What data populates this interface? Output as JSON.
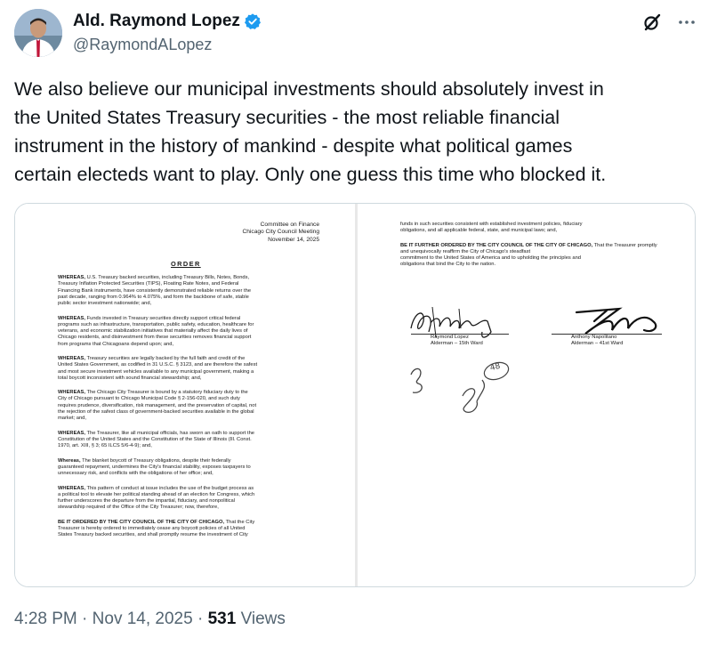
{
  "author": {
    "name": "Ald. Raymond Lopez",
    "handle": "@RaymondALopez",
    "verified_color": "#1d9bf0"
  },
  "icons": {
    "grok": "grok-icon",
    "more": "more-options-icon",
    "verified": "verified-badge-icon"
  },
  "tweet": {
    "lines": [
      "We also believe our municipal investments should absolutely invest in",
      "the United States Treasury securities - the most reliable financial",
      "instrument in the history of mankind - despite what political games",
      "certain electeds want to play. Only one guess this time who blocked it."
    ]
  },
  "document": {
    "left": {
      "header": [
        "Committee on Finance",
        "Chicago City Council Meeting",
        "November 14, 2025"
      ],
      "title": "ORDER",
      "paragraphs": [
        {
          "lead": "WHEREAS,",
          "lines": [
            "U.S. Treasury backed securities, including Treasury Bills, Notes, Bonds,",
            "Treasury Inflation Protected Securities (TIPS), Floating Rate Notes, and Federal",
            "Financing Bank instruments, have consistently demonstrated reliable returns over the",
            "past decade, ranging from 0.964% to 4.075%, and form the backbone of safe, stable",
            "public sector investment nationwide; and,"
          ]
        },
        {
          "lead": "WHEREAS,",
          "lines": [
            "Funds invested in Treasury securities directly support critical federal",
            "programs such as infrastructure, transportation, public safety, education, healthcare for",
            "veterans, and economic stabilization initiatives that materially affect the daily lives of",
            "Chicago residents, and disinvestment from these securities removes financial support",
            "from programs that Chicagoans depend upon; and,"
          ]
        },
        {
          "lead": "WHEREAS,",
          "lines": [
            "Treasury securities are legally backed by the full faith and credit of the",
            "United States Government, as codified in 31 U.S.C. § 3123, and are therefore the safest",
            "and most secure investment vehicles available to any municipal government, making a",
            "total boycott inconsistent with sound financial stewardship; and,"
          ]
        },
        {
          "lead": "WHEREAS,",
          "lines": [
            "The Chicago City Treasurer is bound by a statutory fiduciary duty to the",
            "City of Chicago pursuant to Chicago Municipal Code § 2-156-020, and such duty",
            "requires prudence, diversification, risk management, and the preservation of capital, not",
            "the rejection of the safest class of government-backed securities available in the global",
            "market; and,"
          ]
        },
        {
          "lead": "WHEREAS,",
          "lines": [
            "The Treasurer, like all municipal officials, has sworn an oath to support the",
            "Constitution of the United States and the Constitution of the State of Illinois (Ill. Const.",
            "1970, art. XIII, § 3; 65 ILCS 5/6-4-9); and,"
          ]
        },
        {
          "lead": "Whereas,",
          "lines": [
            "The blanket boycott of Treasury obligations, despite their federally",
            "guaranteed repayment, undermines the City's financial stability, exposes taxpayers to",
            "unnecessary risk, and conflicts with the obligations of her office; and,"
          ]
        },
        {
          "lead": "WHEREAS,",
          "lines": [
            "This pattern of conduct at issue includes the use of the budget process as",
            "a political tool to elevate her political standing ahead of an election for Congress, which",
            "further underscores the departure from the impartial, fiduciary, and nonpolitical",
            "stewardship required of the Office of the City Treasurer; now, therefore,"
          ]
        },
        {
          "lead": "BE IT ORDERED BY THE CITY COUNCIL OF THE CITY OF CHICAGO,",
          "lines": [
            "That the City",
            "Treasurer is hereby ordered to immediately cease any boycott policies of all United",
            "States Treasury backed securities, and shall promptly resume the investment of City"
          ]
        }
      ]
    },
    "right": {
      "paragraphs": [
        {
          "lead": "",
          "lines": [
            "funds in such securities consistent with established investment policies, fiduciary",
            "obligations, and all applicable federal, state, and municipal laws; and,"
          ]
        },
        {
          "lead": "BE IT FURTHER ORDERED BY THE CITY COUNCIL OF THE CITY OF CHICAGO,",
          "lines": [
            "That the Treasurer promptly and unequivocally reaffirm the City of Chicago's steadfast",
            "commitment to the United States of America and to upholding the principles and",
            "obligations that bind the City to the nation."
          ]
        }
      ],
      "signatories": [
        {
          "name": "Raymond Lopez",
          "title": "Alderman – 15th Ward"
        },
        {
          "name": "Anthony Napolitano",
          "title": "Alderman – 41st Ward"
        }
      ],
      "handwritten_notes": [
        "48",
        "3"
      ]
    }
  },
  "meta": {
    "time": "4:28 PM",
    "sep": "·",
    "date": "Nov 14, 2025",
    "views_count": "531",
    "views_label": "Views"
  }
}
